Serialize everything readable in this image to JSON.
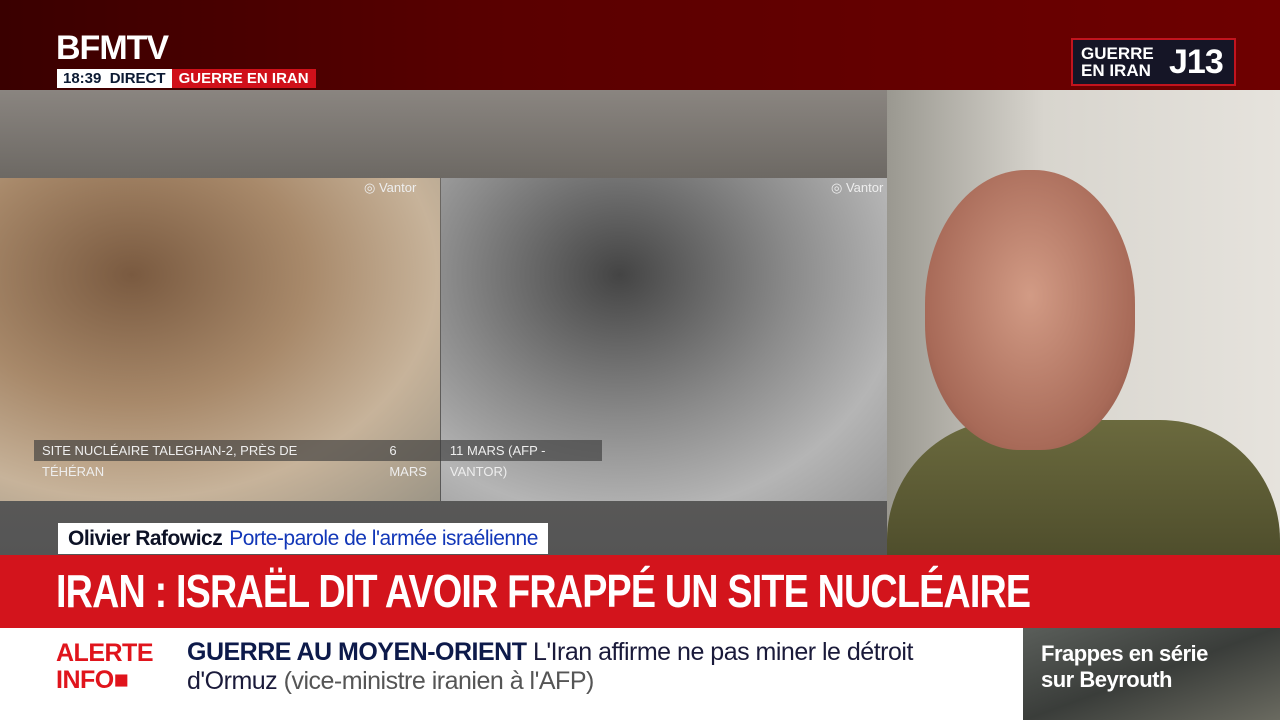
{
  "channel": {
    "logo": "BFMTV",
    "time": "18:39",
    "live": "DIRECT",
    "topic": "GUERRE EN IRAN"
  },
  "badge": {
    "line1": "GUERRE",
    "line2": "EN IRAN",
    "day": "J13"
  },
  "graphic": {
    "watermark": "Vantor",
    "caption_title": "SITE NUCLÉAIRE TALEGHAN-2, PRÈS DE TÉHÉRAN",
    "date_before": "6 MARS",
    "date_after": "11 MARS (AFP - VANTOR)"
  },
  "speaker": {
    "name": "Olivier Rafowicz",
    "role": "Porte-parole de l'armée israélienne"
  },
  "headline": "IRAN : ISRAËL DIT AVOIR FRAPPÉ UN SITE NUCLÉAIRE",
  "ticker": {
    "label1": "ALERTE",
    "label2": "INFO",
    "section": "GUERRE AU MOYEN-ORIENT",
    "text": "L'Iran affirme ne pas miner le détroit d'Ormuz",
    "source": "(vice-ministre iranien à l'AFP)"
  },
  "next": {
    "line1": "Frappes en série",
    "line2": "sur Beyrouth"
  }
}
